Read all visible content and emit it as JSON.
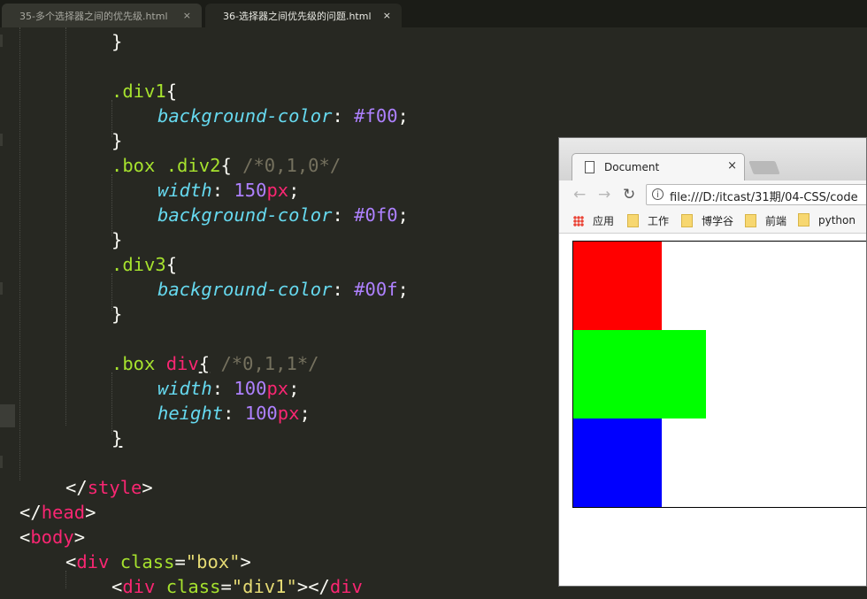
{
  "editor_tabs": [
    {
      "label": "35-多个选择器之间的优先级.html",
      "close": "×"
    },
    {
      "label": "36-选择器之间优先级的问题.html",
      "close": "×"
    }
  ],
  "code": {
    "l1": "}",
    "div1_sel": ".div1",
    "brace_open": "{",
    "brace_close": "}",
    "bg_prop": "background-color",
    "colon": ": ",
    "semi": ";",
    "div1_val": "#f00",
    "box_div2_sel_a": ".box",
    "box_div2_sel_b": ".div2",
    "cmt_010": "/*0,1,0*/",
    "width_prop": "width",
    "num_150": "150",
    "unit_px": "px",
    "div2_val": "#0f0",
    "div3_sel": ".div3",
    "div3_val": "#00f",
    "box_div_sel_a": ".box",
    "box_div_sel_b": "div",
    "cmt_011": "/*0,1,1*/",
    "num_100": "100",
    "height_prop": "height",
    "lt": "<",
    "lt_slash": "</",
    "gt": ">",
    "tag_style": "style",
    "tag_head": "head",
    "tag_body": "body",
    "tag_div": "div",
    "attr_class": "class",
    "eq": "=",
    "str_box": "\"box\"",
    "str_div1": "\"div1\""
  },
  "browser": {
    "tab_title": "Document",
    "tab_close": "×",
    "back": "←",
    "forward": "→",
    "reload": "↻",
    "info": "i",
    "url": "file:///D:/itcast/31期/04-CSS/code",
    "bookmarks": [
      "应用",
      "工作",
      "博学谷",
      "前端",
      "python"
    ]
  },
  "colors": {
    "div1": "#f00",
    "div2": "#0f0",
    "div3": "#00f"
  }
}
